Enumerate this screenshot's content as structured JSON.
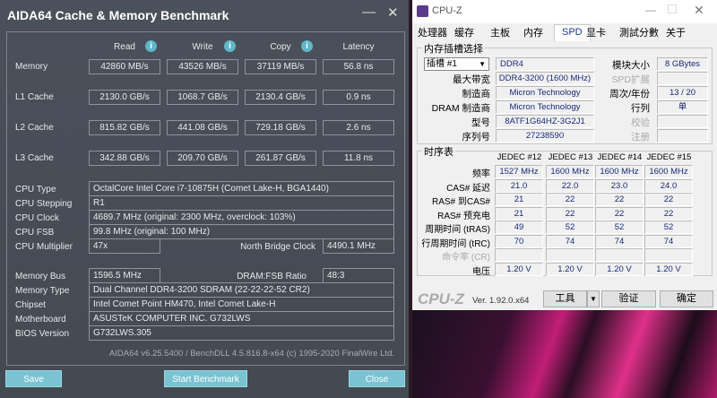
{
  "aida": {
    "title": "AIDA64 Cache & Memory Benchmark",
    "headers": [
      "Read",
      "Write",
      "Copy",
      "Latency"
    ],
    "bench": [
      {
        "label": "Memory",
        "values": [
          "42860 MB/s",
          "43526 MB/s",
          "37119 MB/s",
          "56.8 ns"
        ]
      },
      {
        "label": "L1 Cache",
        "values": [
          "2130.0 GB/s",
          "1068.7 GB/s",
          "2130.4 GB/s",
          "0.9 ns"
        ]
      },
      {
        "label": "L2 Cache",
        "values": [
          "815.82 GB/s",
          "441.08 GB/s",
          "729.18 GB/s",
          "2.6 ns"
        ]
      },
      {
        "label": "L3 Cache",
        "values": [
          "342.88 GB/s",
          "209.70 GB/s",
          "261.87 GB/s",
          "11.8 ns"
        ]
      }
    ],
    "cpu_type": {
      "label": "CPU Type",
      "value": "OctalCore Intel Core i7-10875H  (Comet Lake-H, BGA1440)"
    },
    "cpu_stepping": {
      "label": "CPU Stepping",
      "value": "R1"
    },
    "cpu_clock": {
      "label": "CPU Clock",
      "value": "4689.7 MHz  (original: 2300 MHz, overclock: 103%)"
    },
    "cpu_fsb": {
      "label": "CPU FSB",
      "value": "99.8 MHz  (original: 100 MHz)"
    },
    "cpu_mult": {
      "label": "CPU Multiplier",
      "value": "47x"
    },
    "nb_clock": {
      "label": "North Bridge Clock",
      "value": "4490.1 MHz"
    },
    "mem_bus": {
      "label": "Memory Bus",
      "value": "1596.5 MHz"
    },
    "dram_ratio": {
      "label": "DRAM:FSB Ratio",
      "value": "48:3"
    },
    "mem_type": {
      "label": "Memory Type",
      "value": "Dual Channel DDR4-3200 SDRAM  (22-22-22-52 CR2)"
    },
    "chipset": {
      "label": "Chipset",
      "value": "Intel Comet Point HM470, Intel Comet Lake-H"
    },
    "motherboard": {
      "label": "Motherboard",
      "value": "ASUSTeK COMPUTER INC. G732LWS"
    },
    "bios": {
      "label": "BIOS Version",
      "value": "G732LWS.305"
    },
    "footer": "AIDA64 v6.25.5400 / BenchDLL 4.5.816.8-x64  (c) 1995-2020 FinalWire Ltd.",
    "save": "Save",
    "start": "Start Benchmark",
    "close": "Close"
  },
  "cpuz": {
    "title": "CPU-Z",
    "tabs": [
      "处理器",
      "缓存",
      "主板",
      "内存",
      "SPD",
      "显卡",
      "測試分數",
      "关于"
    ],
    "slot_group": "内存插槽选择",
    "slot": "插槽 #1",
    "type": "DDR4",
    "module_size_label": "模块大小",
    "module_size": "8 GBytes",
    "max_bw_label": "最大带宽",
    "max_bw": "DDR4-3200 (1600 MHz)",
    "spd_ext_label": "SPD扩展",
    "mfr_label": "制造商",
    "mfr": "Micron Technology",
    "week_year_label": "周次/年份",
    "week_year": "13 / 20",
    "dram_mfr_label": "DRAM 制造商",
    "dram_mfr": "Micron Technology",
    "ranks_label": "行列",
    "ranks": "单",
    "part_label": "型号",
    "part": "8ATF1G64HZ-3G2J1",
    "check_label": "校验",
    "serial_label": "序列号",
    "serial": "27238590",
    "reg_label": "注册",
    "timing_group": "时序表",
    "jedec": [
      "JEDEC #12",
      "JEDEC #13",
      "JEDEC #14",
      "JEDEC #15"
    ],
    "timing_rows": [
      {
        "label": "频率",
        "values": [
          "1527 MHz",
          "1600 MHz",
          "1600 MHz",
          "1600 MHz"
        ]
      },
      {
        "label": "CAS# 延迟",
        "values": [
          "21.0",
          "22.0",
          "23.0",
          "24.0"
        ]
      },
      {
        "label": "RAS# 到CAS#",
        "values": [
          "21",
          "22",
          "22",
          "22"
        ]
      },
      {
        "label": "RAS# 预充电",
        "values": [
          "21",
          "22",
          "22",
          "22"
        ]
      },
      {
        "label": "周期时间 (tRAS)",
        "values": [
          "49",
          "52",
          "52",
          "52"
        ]
      },
      {
        "label": "行周期时间 (tRC)",
        "values": [
          "70",
          "74",
          "74",
          "74"
        ]
      },
      {
        "label": "命令率 (CR)",
        "values": [
          "",
          "",
          "",
          ""
        ]
      },
      {
        "label": "电压",
        "values": [
          "1.20 V",
          "1.20 V",
          "1.20 V",
          "1.20 V"
        ]
      }
    ],
    "logo": "CPU-Z",
    "version": "Ver. 1.92.0.x64",
    "tools": "工具",
    "validate": "验证",
    "ok": "确定"
  }
}
